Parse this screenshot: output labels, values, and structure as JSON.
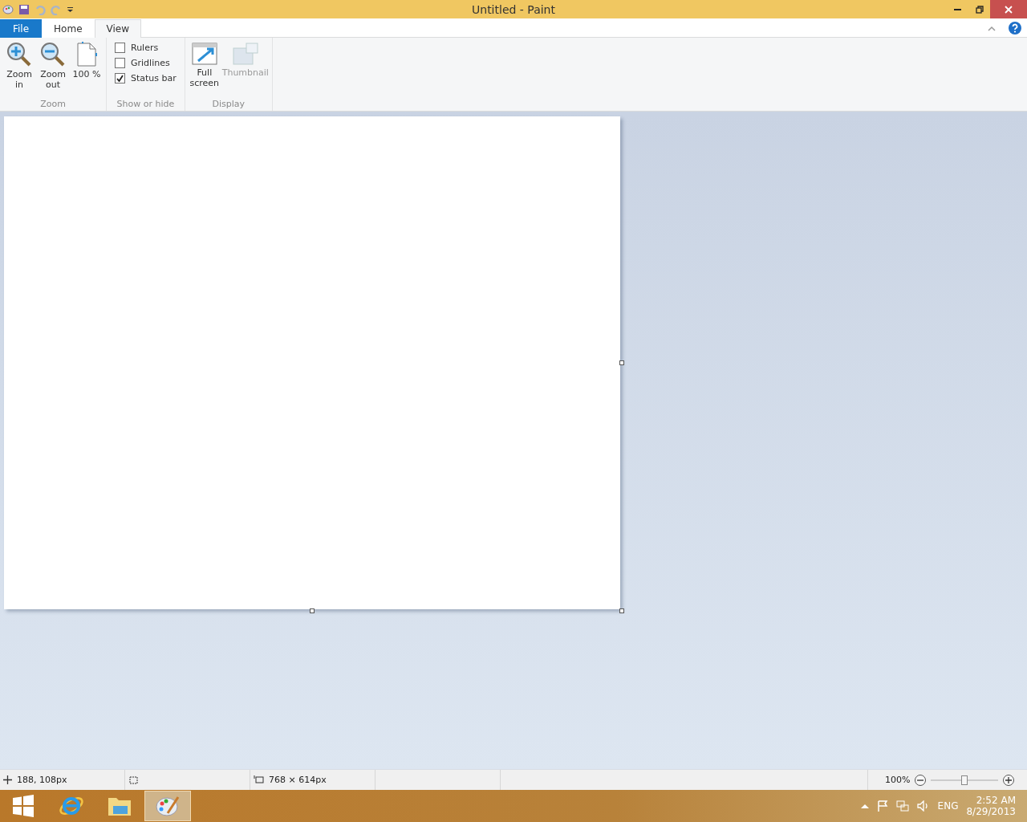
{
  "window": {
    "title": "Untitled - Paint"
  },
  "tabs": [
    {
      "label": "File",
      "kind": "file",
      "selected": false
    },
    {
      "label": "Home",
      "kind": "tab",
      "selected": false
    },
    {
      "label": "View",
      "kind": "tab",
      "selected": true
    }
  ],
  "ribbon": {
    "groups": [
      {
        "label": "Zoom",
        "kind": "buttons",
        "items": [
          {
            "label": "Zoom in",
            "kind": "zoomin",
            "disabled": false
          },
          {
            "label": "Zoom out",
            "kind": "zoomout",
            "disabled": false
          },
          {
            "label": "100 %",
            "kind": "page",
            "disabled": false
          }
        ]
      },
      {
        "label": "Show or hide",
        "kind": "checks",
        "items": [
          {
            "label": "Rulers",
            "checked": false
          },
          {
            "label": "Gridlines",
            "checked": false
          },
          {
            "label": "Status bar",
            "checked": true
          }
        ]
      },
      {
        "label": "Display",
        "kind": "buttons",
        "items": [
          {
            "label": "Full screen",
            "kind": "fullscreen",
            "disabled": false
          },
          {
            "label": "Thumbnail",
            "kind": "thumbnail",
            "disabled": true
          }
        ]
      }
    ]
  },
  "status_bar": {
    "position": "188, 108px",
    "size": "768 × 614px",
    "zoom": "100%",
    "zoom_slider": {
      "level": 0.5
    }
  },
  "taskbar": {
    "apps": [
      {
        "kind": "explorer",
        "selected": false
      },
      {
        "kind": "ie",
        "selected": false
      },
      {
        "kind": "files",
        "selected": false
      },
      {
        "kind": "paint",
        "selected": true
      }
    ],
    "language": "ENG",
    "time": "2:52 AM",
    "date": "8/29/2013"
  }
}
